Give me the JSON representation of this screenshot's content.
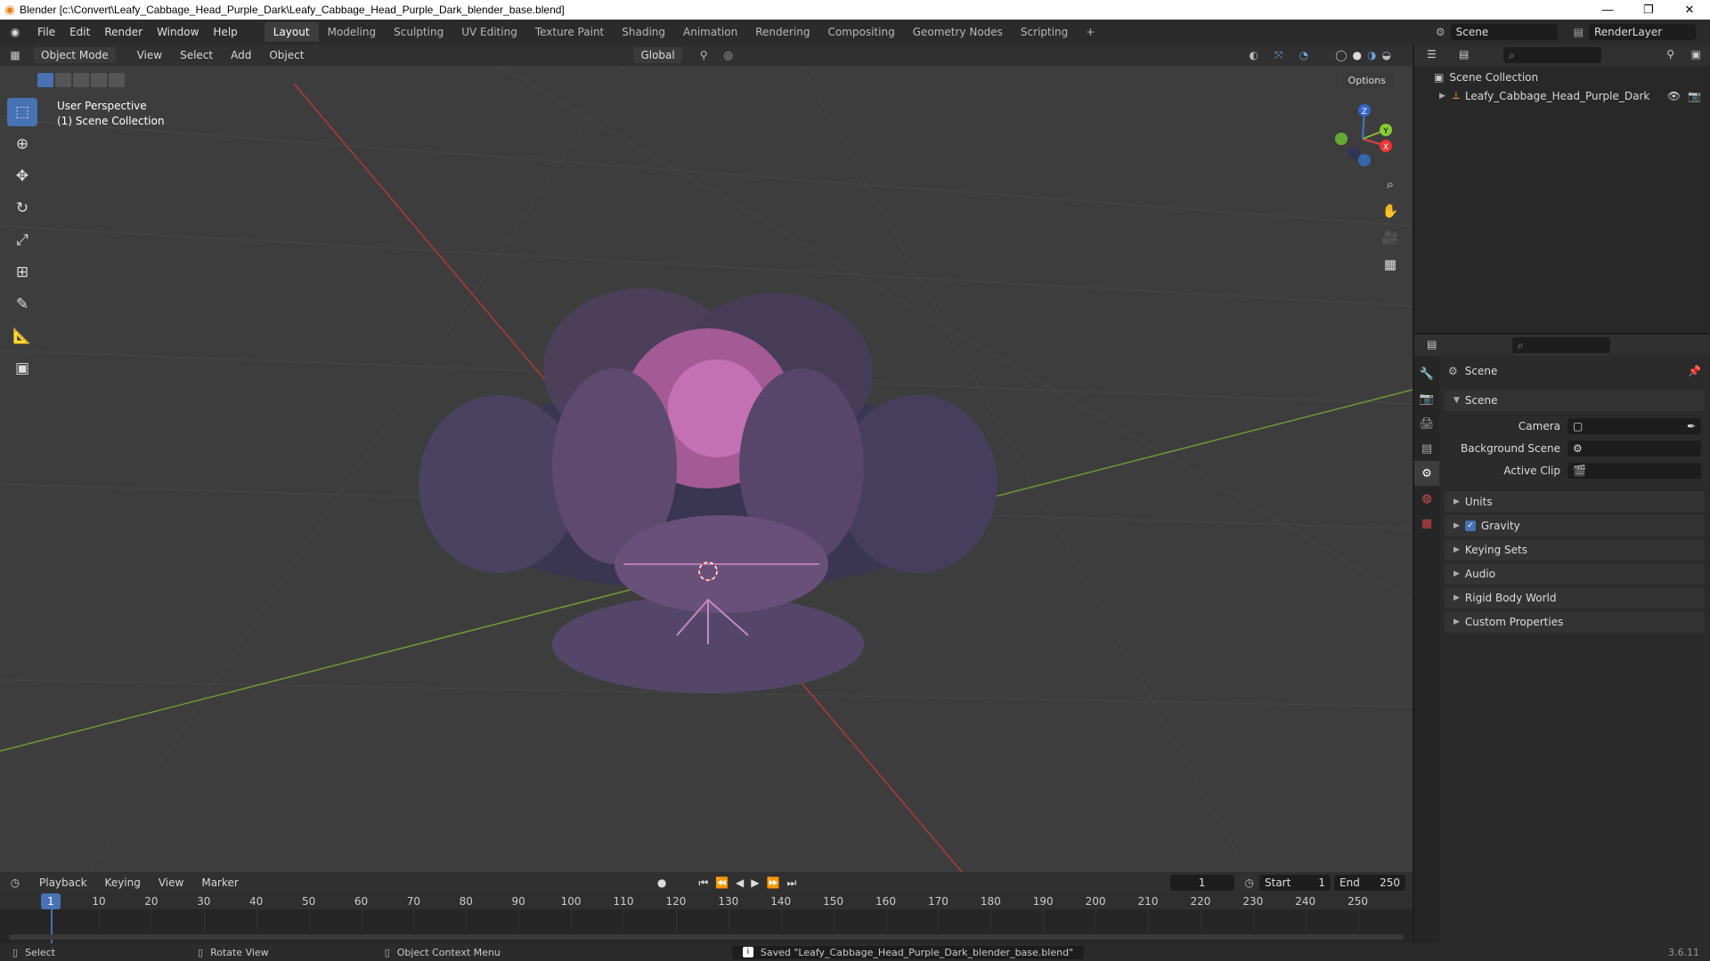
{
  "window": {
    "title": "Blender [c:\\Convert\\Leafy_Cabbage_Head_Purple_Dark\\Leafy_Cabbage_Head_Purple_Dark_blender_base.blend]",
    "minimize": "—",
    "maximize": "❐",
    "close": "✕"
  },
  "menus": [
    "File",
    "Edit",
    "Render",
    "Window",
    "Help"
  ],
  "workspaces": [
    "Layout",
    "Modeling",
    "Sculpting",
    "UV Editing",
    "Texture Paint",
    "Shading",
    "Animation",
    "Rendering",
    "Compositing",
    "Geometry Nodes",
    "Scripting"
  ],
  "workspace_add": "+",
  "scene": {
    "name": "Scene",
    "layer": "RenderLayer"
  },
  "viewport": {
    "mode": "Object Mode",
    "menus": [
      "View",
      "Select",
      "Add",
      "Object"
    ],
    "orientation": "Global",
    "options": "Options",
    "perspective": "User Perspective",
    "collection": "(1) Scene Collection"
  },
  "gizmo": {
    "x": "X",
    "y": "Y",
    "z": "Z"
  },
  "outliner": {
    "root": "Scene Collection",
    "item": "Leafy_Cabbage_Head_Purple_Dark"
  },
  "properties": {
    "title": "Scene",
    "panel": "Scene",
    "camera_label": "Camera",
    "bg_label": "Background Scene",
    "clip_label": "Active Clip",
    "sections": [
      "Units",
      "Gravity",
      "Keying Sets",
      "Audio",
      "Rigid Body World",
      "Custom Properties"
    ]
  },
  "timeline": {
    "menus": [
      "Playback",
      "Keying",
      "View",
      "Marker"
    ],
    "current": "1",
    "start_label": "Start",
    "start": "1",
    "end_label": "End",
    "end": "250",
    "ticks": [
      "1",
      "10",
      "20",
      "30",
      "40",
      "50",
      "60",
      "70",
      "80",
      "90",
      "100",
      "110",
      "120",
      "130",
      "140",
      "150",
      "160",
      "170",
      "180",
      "190",
      "200",
      "210",
      "220",
      "230",
      "240",
      "250"
    ]
  },
  "status": {
    "select": "Select",
    "rotate": "Rotate View",
    "context": "Object Context Menu",
    "message": "Saved \"Leafy_Cabbage_Head_Purple_Dark_blender_base.blend\"",
    "version": "3.6.11"
  }
}
